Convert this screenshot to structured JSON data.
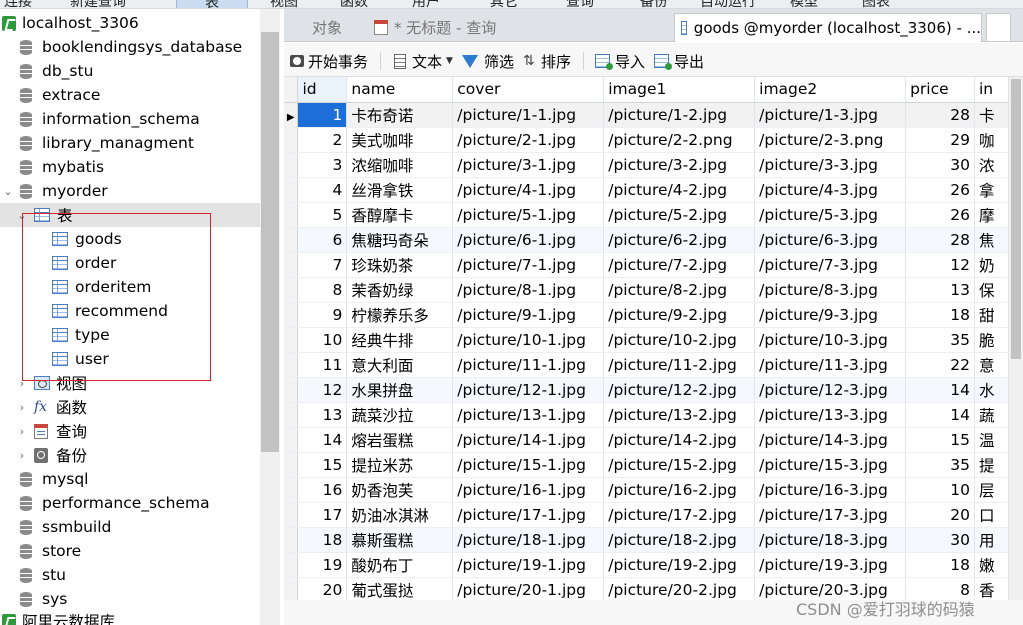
{
  "topbar": {
    "items": [
      "连接",
      "新建查询",
      "表",
      "视图",
      "函数",
      "用户",
      "其它",
      "查询",
      "备份",
      "自动运行",
      "模型",
      "图表"
    ]
  },
  "sidebar": {
    "connection": "localhost_3306",
    "databases_before": [
      "booklendingsys_database",
      "db_stu",
      "extrace",
      "information_schema",
      "library_managment",
      "mybatis"
    ],
    "open_database": "myorder",
    "tables_folder": "表",
    "tables": [
      "goods",
      "order",
      "orderitem",
      "recommend",
      "type",
      "user"
    ],
    "folders": {
      "views": "视图",
      "functions": "函数",
      "queries": "查询",
      "backups": "备份"
    },
    "databases_after": [
      "mysql",
      "performance_schema",
      "ssmbuild",
      "store",
      "stu",
      "sys"
    ],
    "next_connection": "阿里云数据库"
  },
  "tabs": {
    "objects": "对象",
    "untitled_query": "* 无标题 - 查询",
    "goods_tab": "goods @myorder (localhost_3306) - ..."
  },
  "toolbar": {
    "begin_transaction": "开始事务",
    "text": "文本",
    "filter": "筛选",
    "sort": "排序",
    "import": "导入",
    "export": "导出"
  },
  "grid": {
    "columns": [
      "id",
      "name",
      "cover",
      "image1",
      "image2",
      "price",
      "in"
    ],
    "rows": [
      {
        "id": "1",
        "name": "卡布奇诺",
        "cover": "/picture/1-1.jpg",
        "image1": "/picture/1-2.jpg",
        "image2": "/picture/1-3.jpg",
        "price": "28",
        "intro": "卡"
      },
      {
        "id": "2",
        "name": "美式咖啡",
        "cover": "/picture/2-1.jpg",
        "image1": "/picture/2-2.png",
        "image2": "/picture/2-3.png",
        "price": "29",
        "intro": "咖"
      },
      {
        "id": "3",
        "name": "浓缩咖啡",
        "cover": "/picture/3-1.jpg",
        "image1": "/picture/3-2.jpg",
        "image2": "/picture/3-3.jpg",
        "price": "30",
        "intro": "浓"
      },
      {
        "id": "4",
        "name": "丝滑拿铁",
        "cover": "/picture/4-1.jpg",
        "image1": "/picture/4-2.jpg",
        "image2": "/picture/4-3.jpg",
        "price": "26",
        "intro": "拿"
      },
      {
        "id": "5",
        "name": "香醇摩卡",
        "cover": "/picture/5-1.jpg",
        "image1": "/picture/5-2.jpg",
        "image2": "/picture/5-3.jpg",
        "price": "26",
        "intro": "摩"
      },
      {
        "id": "6",
        "name": "焦糖玛奇朵",
        "cover": "/picture/6-1.jpg",
        "image1": "/picture/6-2.jpg",
        "image2": "/picture/6-3.jpg",
        "price": "28",
        "intro": "焦"
      },
      {
        "id": "7",
        "name": "珍珠奶茶",
        "cover": "/picture/7-1.jpg",
        "image1": "/picture/7-2.jpg",
        "image2": "/picture/7-3.jpg",
        "price": "12",
        "intro": "奶"
      },
      {
        "id": "8",
        "name": "茉香奶绿",
        "cover": "/picture/8-1.jpg",
        "image1": "/picture/8-2.jpg",
        "image2": "/picture/8-3.jpg",
        "price": "13",
        "intro": "保"
      },
      {
        "id": "9",
        "name": "柠檬养乐多",
        "cover": "/picture/9-1.jpg",
        "image1": "/picture/9-2.jpg",
        "image2": "/picture/9-3.jpg",
        "price": "18",
        "intro": "甜"
      },
      {
        "id": "10",
        "name": "经典牛排",
        "cover": "/picture/10-1.jpg",
        "image1": "/picture/10-2.jpg",
        "image2": "/picture/10-3.jpg",
        "price": "35",
        "intro": "脆"
      },
      {
        "id": "11",
        "name": "意大利面",
        "cover": "/picture/11-1.jpg",
        "image1": "/picture/11-2.jpg",
        "image2": "/picture/11-3.jpg",
        "price": "22",
        "intro": "意"
      },
      {
        "id": "12",
        "name": "水果拼盘",
        "cover": "/picture/12-1.jpg",
        "image1": "/picture/12-2.jpg",
        "image2": "/picture/12-3.jpg",
        "price": "14",
        "intro": "水"
      },
      {
        "id": "13",
        "name": "蔬菜沙拉",
        "cover": "/picture/13-1.jpg",
        "image1": "/picture/13-2.jpg",
        "image2": "/picture/13-3.jpg",
        "price": "14",
        "intro": "蔬"
      },
      {
        "id": "14",
        "name": "熔岩蛋糕",
        "cover": "/picture/14-1.jpg",
        "image1": "/picture/14-2.jpg",
        "image2": "/picture/14-3.jpg",
        "price": "15",
        "intro": "温"
      },
      {
        "id": "15",
        "name": "提拉米苏",
        "cover": "/picture/15-1.jpg",
        "image1": "/picture/15-2.jpg",
        "image2": "/picture/15-3.jpg",
        "price": "35",
        "intro": "提"
      },
      {
        "id": "16",
        "name": "奶香泡芙",
        "cover": "/picture/16-1.jpg",
        "image1": "/picture/16-2.jpg",
        "image2": "/picture/16-3.jpg",
        "price": "10",
        "intro": "层"
      },
      {
        "id": "17",
        "name": "奶油冰淇淋",
        "cover": "/picture/17-1.jpg",
        "image1": "/picture/17-2.jpg",
        "image2": "/picture/17-3.jpg",
        "price": "20",
        "intro": "口"
      },
      {
        "id": "18",
        "name": "慕斯蛋糕",
        "cover": "/picture/18-1.jpg",
        "image1": "/picture/18-2.jpg",
        "image2": "/picture/18-3.jpg",
        "price": "30",
        "intro": "用"
      },
      {
        "id": "19",
        "name": "酸奶布丁",
        "cover": "/picture/19-1.jpg",
        "image1": "/picture/19-2.jpg",
        "image2": "/picture/19-3.jpg",
        "price": "18",
        "intro": "嫩"
      },
      {
        "id": "20",
        "name": "葡式蛋挞",
        "cover": "/picture/20-1.jpg",
        "image1": "/picture/20-2.jpg",
        "image2": "/picture/20-3.jpg",
        "price": "8",
        "intro": "香"
      }
    ]
  },
  "watermark": "CSDN @爱打羽球的码猿",
  "colors": {
    "selection": "#1e6ed8",
    "annotation_box": "#d2242a",
    "connection_icon": "#2f9a3d"
  }
}
